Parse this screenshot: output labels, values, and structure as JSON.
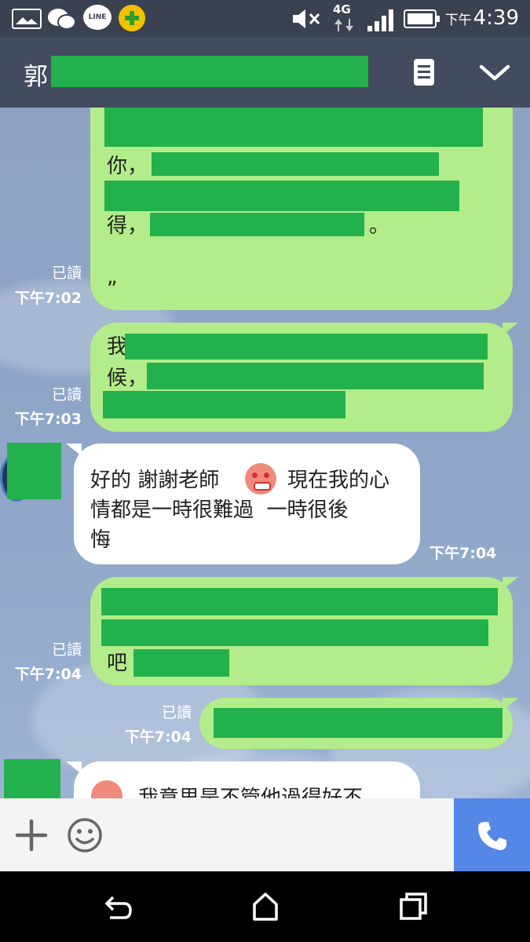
{
  "status_bar": {
    "time_prefix": "下午",
    "time": "4:39",
    "network": "4G",
    "line_icon_text": "LINE"
  },
  "header": {
    "title_visible": "郭"
  },
  "messages": {
    "m1": {
      "read": "已讀",
      "time": "下午7:02",
      "line1": "你，",
      "line2": "得，",
      "line2_end": "。",
      "line3": "„"
    },
    "m2": {
      "read": "已讀",
      "time": "下午7:03",
      "line1": "我",
      "line2": "候，"
    },
    "m3": {
      "time": "下午7:04",
      "line1_a": "好的 謝謝老師",
      "line1_b": "現在我的心",
      "line2": "情都是一時很難過  一時很後",
      "line3": "悔"
    },
    "m4": {
      "read": "已讀",
      "time": "下午7:04",
      "line3": "吧"
    },
    "m5": {
      "read": "已讀",
      "time": "下午7:04"
    },
    "m6": {
      "line1": "我意思是不管他過得好不"
    }
  },
  "colors": {
    "redaction": "#22b14c",
    "my_bubble": "#b3ec8a",
    "their_bubble": "#ffffff",
    "call_button": "#5587e6"
  }
}
